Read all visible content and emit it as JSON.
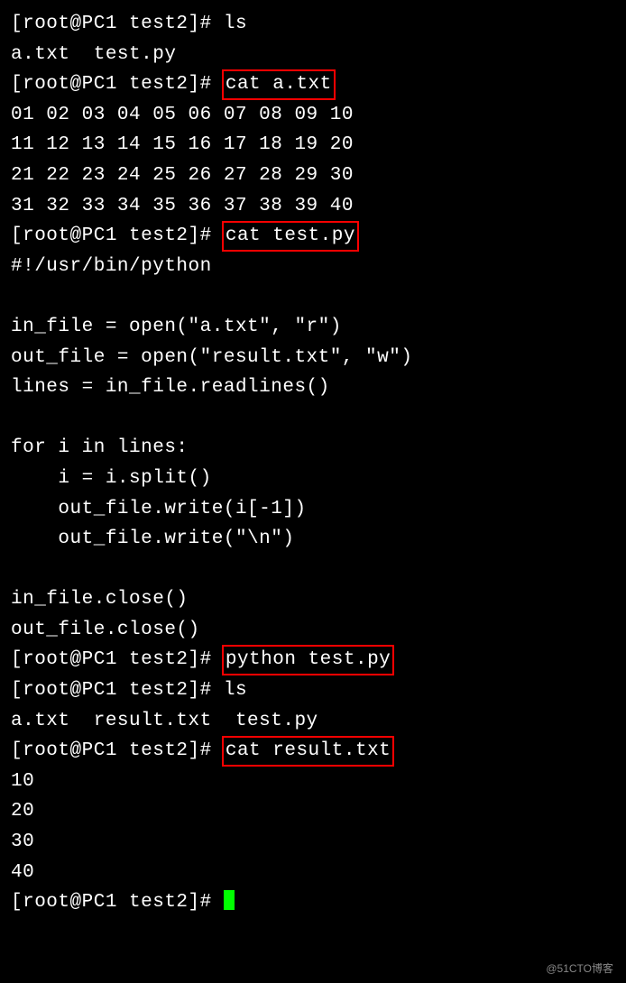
{
  "prompt": "[root@PC1 test2]# ",
  "lines": [
    {
      "type": "cmd",
      "text": "ls"
    },
    {
      "type": "out",
      "text": "a.txt  test.py"
    },
    {
      "type": "cmd-hl",
      "text": "cat a.txt"
    },
    {
      "type": "out",
      "text": "01 02 03 04 05 06 07 08 09 10"
    },
    {
      "type": "out",
      "text": "11 12 13 14 15 16 17 18 19 20"
    },
    {
      "type": "out",
      "text": "21 22 23 24 25 26 27 28 29 30"
    },
    {
      "type": "out",
      "text": "31 32 33 34 35 36 37 38 39 40"
    },
    {
      "type": "cmd-hl",
      "text": "cat test.py"
    },
    {
      "type": "out",
      "text": "#!/usr/bin/python"
    },
    {
      "type": "out",
      "text": ""
    },
    {
      "type": "out",
      "text": "in_file = open(\"a.txt\", \"r\")"
    },
    {
      "type": "out",
      "text": "out_file = open(\"result.txt\", \"w\")"
    },
    {
      "type": "out",
      "text": "lines = in_file.readlines()"
    },
    {
      "type": "out",
      "text": ""
    },
    {
      "type": "out",
      "text": "for i in lines:"
    },
    {
      "type": "out",
      "text": "    i = i.split()"
    },
    {
      "type": "out",
      "text": "    out_file.write(i[-1])"
    },
    {
      "type": "out",
      "text": "    out_file.write(\"\\n\")"
    },
    {
      "type": "out",
      "text": ""
    },
    {
      "type": "out",
      "text": "in_file.close()"
    },
    {
      "type": "out",
      "text": "out_file.close()"
    },
    {
      "type": "cmd-hl",
      "text": "python test.py"
    },
    {
      "type": "cmd",
      "text": "ls"
    },
    {
      "type": "out",
      "text": "a.txt  result.txt  test.py"
    },
    {
      "type": "cmd-hl",
      "text": "cat result.txt"
    },
    {
      "type": "out",
      "text": "10"
    },
    {
      "type": "out",
      "text": "20"
    },
    {
      "type": "out",
      "text": "30"
    },
    {
      "type": "out",
      "text": "40"
    },
    {
      "type": "cursor",
      "text": ""
    }
  ],
  "watermark": "@51CTO博客"
}
